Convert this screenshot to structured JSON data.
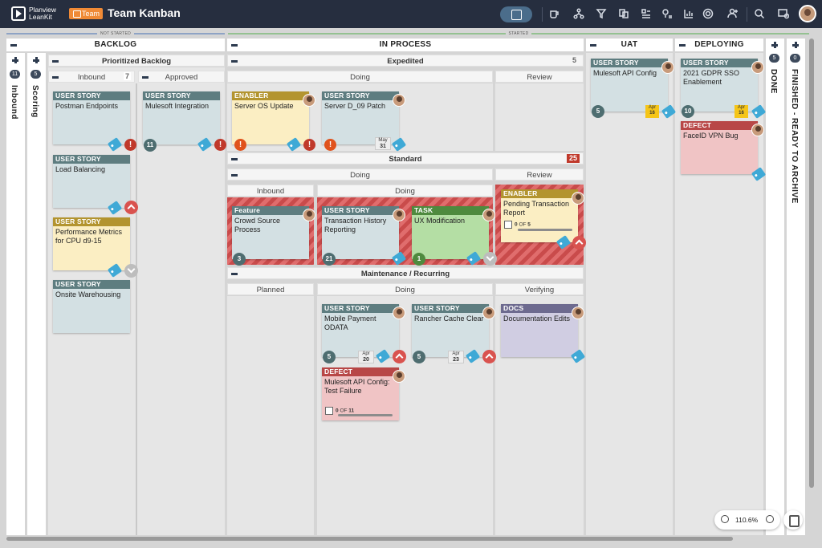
{
  "app": {
    "logo_line1": "Planview",
    "logo_line2": "LeanKit",
    "team_label": "Team",
    "board_title": "Team Kanban"
  },
  "toolbar_icons": [
    "board-icon",
    "coffee-icon",
    "hierarchy-icon",
    "filter-icon",
    "cards-icon",
    "lanes-icon",
    "chart-icon",
    "settings-icon",
    "add-user-icon",
    "search-icon",
    "notifications-icon"
  ],
  "stages": {
    "not_started": "NOT STARTED",
    "started": "STARTED"
  },
  "lanes": {
    "inbound": {
      "title": "Inbound",
      "count": "11"
    },
    "scoring": {
      "title": "Scoring",
      "count": "5"
    },
    "backlog": {
      "title": "BACKLOG",
      "prioritized": "Prioritized Backlog",
      "inbound": "Inbound",
      "inbound_wip": "7",
      "approved": "Approved"
    },
    "inprocess": {
      "title": "IN PROCESS",
      "expedited": "Expedited",
      "expedited_wip": "5",
      "doing": "Doing",
      "review": "Review",
      "standard": "Standard",
      "standard_wip": "25",
      "std_doing": "Doing",
      "std_review": "Review",
      "std_inbound": "Inbound",
      "std_doing2": "Doing",
      "maint": "Maintenance / Recurring",
      "planned": "Planned",
      "m_doing": "Doing",
      "verifying": "Verifying"
    },
    "uat": {
      "title": "UAT"
    },
    "deploying": {
      "title": "DEPLOYING"
    },
    "done": {
      "title": "DONE",
      "count": "5"
    },
    "finished": {
      "title": "FINISHED - READY TO ARCHIVE",
      "count": "0"
    }
  },
  "cards": {
    "c1": {
      "type": "USER STORY",
      "title": "Postman Endpoints"
    },
    "c2": {
      "type": "USER STORY",
      "title": "Load Balancing"
    },
    "c3": {
      "type": "USER STORY",
      "title": "Performance Metrics for CPU d9-15"
    },
    "c4": {
      "type": "USER STORY",
      "title": "Onsite Warehousing"
    },
    "c5": {
      "type": "USER STORY",
      "title": "Mulesoft Integration",
      "num": "11"
    },
    "c6": {
      "type": "ENABLER",
      "title": "Server OS Update"
    },
    "c7": {
      "type": "USER STORY",
      "title": "Server D_09 Patch",
      "date_m": "May",
      "date_d": "31"
    },
    "c8": {
      "type": "Feature",
      "title": "Crowd Source Process",
      "num": "3"
    },
    "c9": {
      "type": "USER STORY",
      "title": "Transaction History Reporting",
      "num": "21"
    },
    "c10": {
      "type": "TASK",
      "title": "UX Modification",
      "num": "1"
    },
    "c11": {
      "type": "ENABLER",
      "title": "Pending Transaction Report",
      "prog_done": "0",
      "prog_of": "OF",
      "prog_total": "5"
    },
    "c12": {
      "type": "USER STORY",
      "title": "Mobile Payment ODATA",
      "num": "5",
      "date_m": "Apr",
      "date_d": "20"
    },
    "c13": {
      "type": "USER STORY",
      "title": "Rancher Cache Clear",
      "num": "5",
      "date_m": "Apr",
      "date_d": "23"
    },
    "c14": {
      "type": "DOCS",
      "title": "Documentation Edits"
    },
    "c15": {
      "type": "DEFECT",
      "title": "Mulesoft API Config: Test Failure",
      "prog_done": "0",
      "prog_of": "OF",
      "prog_total": "11"
    },
    "c16": {
      "type": "USER STORY",
      "title": "Mulesoft API Config",
      "num": "5",
      "date_m": "Apr",
      "date_d": "16"
    },
    "c17": {
      "type": "USER STORY",
      "title": "2021 GDPR SSO Enablement",
      "num": "10",
      "date_m": "Apr",
      "date_d": "16"
    },
    "c18": {
      "type": "DEFECT",
      "title": "FaceID VPN Bug"
    }
  },
  "zoom": {
    "level": "110.6%"
  },
  "colors": {
    "topbar": "#262e3f",
    "story": "#5e7d80",
    "enabler": "#b3942f",
    "defect": "#b84747",
    "task": "#4e8a3e",
    "docs": "#6d6a8f",
    "blocked": "#c0392b"
  }
}
